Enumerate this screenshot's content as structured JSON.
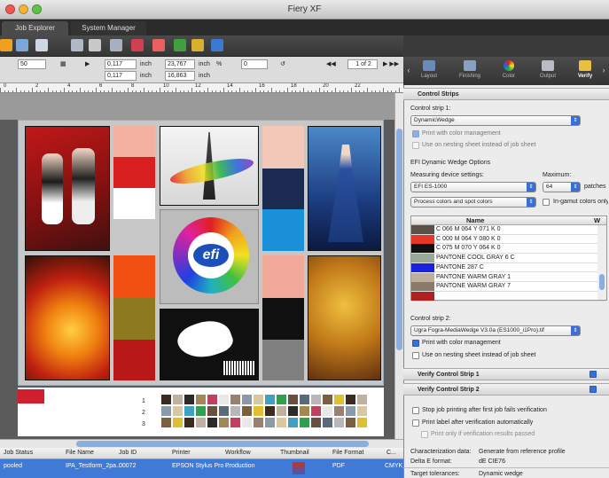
{
  "window": {
    "title": "Fiery XF"
  },
  "tabs": [
    {
      "label": "Job Explorer"
    },
    {
      "label": "System Manager"
    }
  ],
  "props": {
    "x_value": "50",
    "x_offset": "0,117",
    "y_offset": "0,117",
    "width": "23,767",
    "height": "16,863",
    "unit_1": "inch",
    "unit_2": "inch",
    "unit_3": "inch",
    "unit_4": "inch",
    "rotation": "0",
    "percent_sign": "%",
    "page_indicator": "1 of 2"
  },
  "ruler": {
    "ticks": [
      "0",
      "2",
      "4",
      "6",
      "8",
      "10",
      "12",
      "14",
      "16",
      "18",
      "20",
      "22"
    ]
  },
  "canvas": {
    "logo_text": "efi",
    "bottom_labels": [
      "1",
      "2",
      "3"
    ]
  },
  "job_table": {
    "headers": [
      "Job Status",
      "File Name",
      "Job ID",
      "Printer",
      "Workflow",
      "Thumbnail",
      "File Format",
      "C..."
    ],
    "row": {
      "status": "pooled",
      "file_name": "IPA_Testform_2pa...",
      "job_id": "00072",
      "printer": "EPSON Stylus Pro ...",
      "workflow": "Production",
      "format": "PDF",
      "color": "CMYK"
    }
  },
  "right_panel": {
    "tabs": [
      {
        "label": "Layout"
      },
      {
        "label": "Finishing"
      },
      {
        "label": "Color"
      },
      {
        "label": "Output"
      },
      {
        "label": "Verify"
      }
    ],
    "control_strips_title": "Control Strips",
    "strip1_label": "Control strip 1:",
    "strip1_value": "DynamicWedge",
    "print_cm_1": "Print with color management",
    "nesting_1": "Use on nesting sheet instead of job sheet",
    "efi_options": "EFI Dynamic Wedge Options",
    "measuring_label": "Measuring device settings:",
    "measuring_value": "EFI ES-1000",
    "maximum_label": "Maximum:",
    "maximum_value": "64",
    "patches_label": "patches",
    "process_value": "Process colors and spot colors",
    "ingamut_label": "In-gamut colors only",
    "table_header_name": "Name",
    "table_header_w": "W",
    "colors": [
      {
        "name": "C 066  M 064  Y 071  K 0",
        "swatch": "#5a5048"
      },
      {
        "name": "C 000  M 064  Y 080  K 0",
        "swatch": "#e8352a"
      },
      {
        "name": "C 075  M 070  Y 064  K 0",
        "swatch": "#111111"
      },
      {
        "name": "PANTONE COOL GRAY 6 C",
        "swatch": "#9aa89a"
      },
      {
        "name": "PANTONE 287 C",
        "swatch": "#1a22e0"
      },
      {
        "name": "PANTONE WARM GRAY 1",
        "swatch": "#bcae9a"
      },
      {
        "name": "PANTONE WARM GRAY 7",
        "swatch": "#8c7a68"
      },
      {
        "name": "",
        "swatch": "#b02020"
      }
    ],
    "strip2_label": "Control strip 2:",
    "strip2_value": "Ugra Fogra-MediaWedge V3.0a (ES1000_i1Pro).tif",
    "print_cm_2": "Print with color management",
    "nesting_2": "Use on nesting sheet instead of job sheet",
    "verify1": "Verify Control Strip 1",
    "verify2": "Verify Control Strip 2",
    "stop_job": "Stop job printing after first job fails verification",
    "print_label": "Print label after verification automatically",
    "print_only": "Print only if verification results passed",
    "char_label": "Characterization data:",
    "char_value": "Generate from reference profile",
    "delta_label": "Delta E format:",
    "delta_value": "dE CIE76",
    "target_label": "Target tolerances:",
    "target_value": "Dynamic wedge"
  }
}
